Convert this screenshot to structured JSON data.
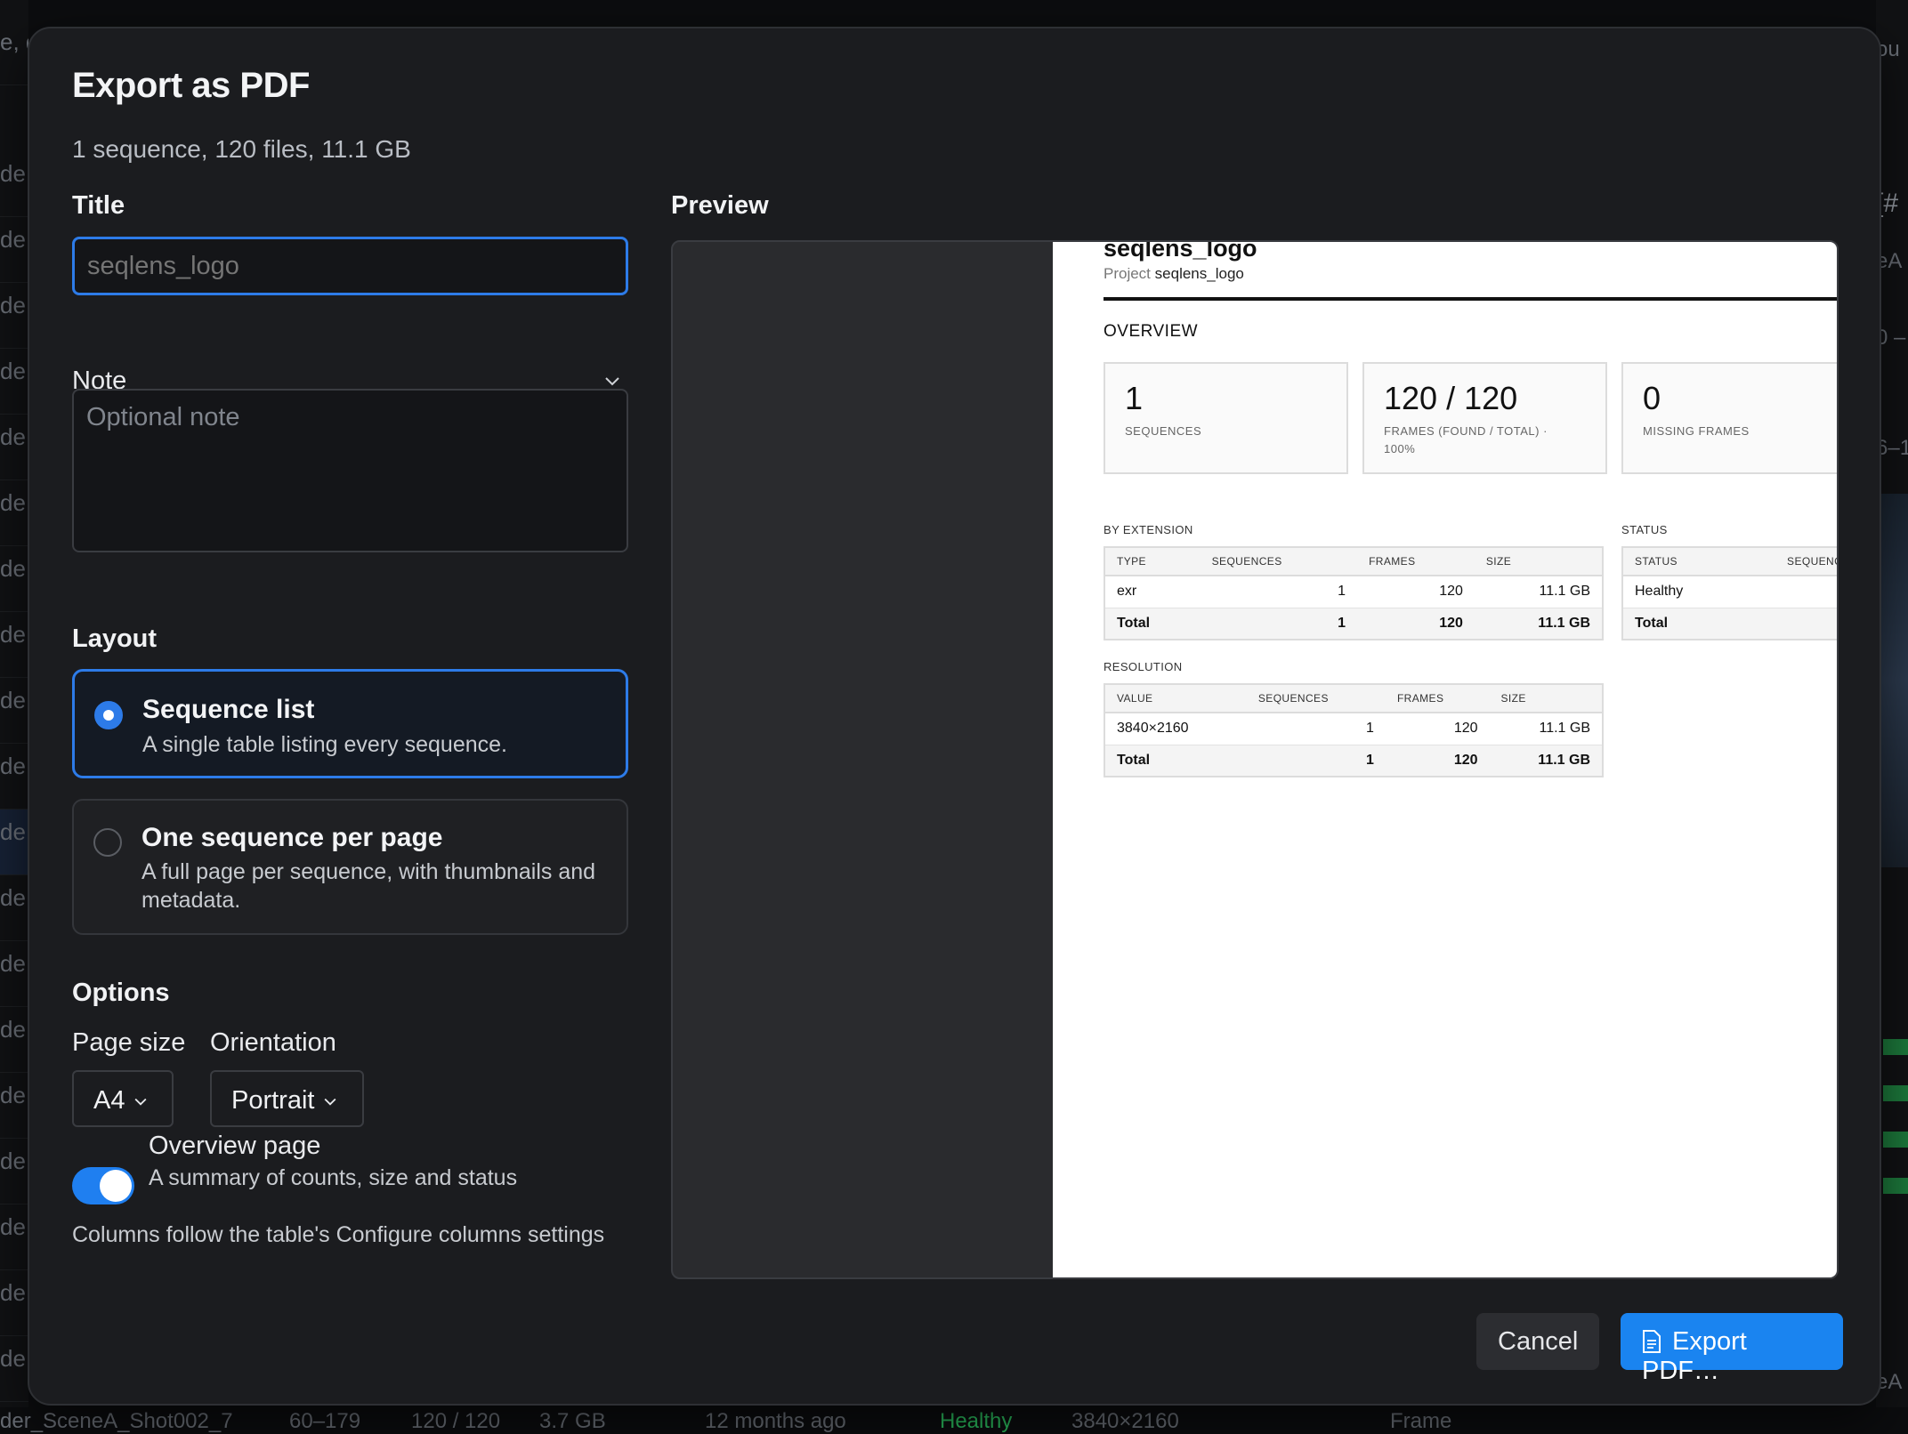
{
  "background": {
    "left_rows": [
      "e, d",
      "de",
      "de",
      "de",
      "de",
      "de",
      "de",
      "de",
      "de",
      "de",
      "de",
      "de",
      "de",
      "de",
      "de",
      "de",
      "de",
      "de",
      "de",
      "de",
      "de"
    ],
    "right_texts": [
      "ou",
      "[#",
      "eA",
      "0 –",
      "6–1",
      "eA"
    ],
    "bottom_row": {
      "name": "der_SceneA_Shot002_7",
      "range": "60–179",
      "frames": "120 / 120",
      "size": "3.7 GB",
      "modified": "12 months ago",
      "status": "Healthy",
      "resolution": "3840×2160",
      "frame_label": "Frame"
    }
  },
  "dialog": {
    "title": "Export as PDF",
    "subtitle": "1 sequence, 120 files, 11.1 GB",
    "title_label": "Title",
    "title_placeholder": "seqlens_logo",
    "note_label": "Note",
    "note_placeholder": "Optional note",
    "layout_label": "Layout",
    "layout_options": [
      {
        "title": "Sequence list",
        "desc": "A single table listing every sequence.",
        "selected": true
      },
      {
        "title": "One sequence per page",
        "desc": "A full page per sequence, with thumbnails and metadata.",
        "selected": false
      }
    ],
    "options_label": "Options",
    "page_size_label": "Page size",
    "page_size_value": "A4",
    "orientation_label": "Orientation",
    "orientation_value": "Portrait",
    "overview_toggle": {
      "label": "Overview page",
      "desc": "A summary of counts, size and status",
      "on": true
    },
    "columns_note": "Columns follow the table's Configure columns settings",
    "preview_label": "Preview",
    "cancel_label": "Cancel",
    "export_label": "Export PDF…"
  },
  "preview_page": {
    "title": "seqlens_logo",
    "project_key": "Project",
    "project_value": "seqlens_logo",
    "overview_heading": "OVERVIEW",
    "cards": [
      {
        "value": "1",
        "label": "SEQUENCES"
      },
      {
        "value": "120 / 120",
        "label": "FRAMES (FOUND / TOTAL) · 100%"
      },
      {
        "value": "0",
        "label": "MISSING FRAMES"
      }
    ],
    "by_extension": {
      "heading": "BY EXTENSION",
      "headers": [
        "TYPE",
        "SEQUENCES",
        "FRAMES",
        "SIZE"
      ],
      "rows": [
        [
          "exr",
          "1",
          "120",
          "11.1 GB"
        ]
      ],
      "total": [
        "Total",
        "1",
        "120",
        "11.1 GB"
      ]
    },
    "status": {
      "heading": "STATUS",
      "headers": [
        "STATUS",
        "SEQUENCES"
      ],
      "rows": [
        [
          "Healthy",
          ""
        ]
      ],
      "total": [
        "Total",
        ""
      ]
    },
    "resolution": {
      "heading": "RESOLUTION",
      "headers": [
        "VALUE",
        "SEQUENCES",
        "FRAMES",
        "SIZE"
      ],
      "rows": [
        [
          "3840×2160",
          "1",
          "120",
          "11.1 GB"
        ]
      ],
      "total": [
        "Total",
        "1",
        "120",
        "11.1 GB"
      ]
    }
  },
  "colors": {
    "accent": "#2d7be8",
    "export_button": "#1a84f0",
    "dialog_bg": "#1b1c1f"
  }
}
